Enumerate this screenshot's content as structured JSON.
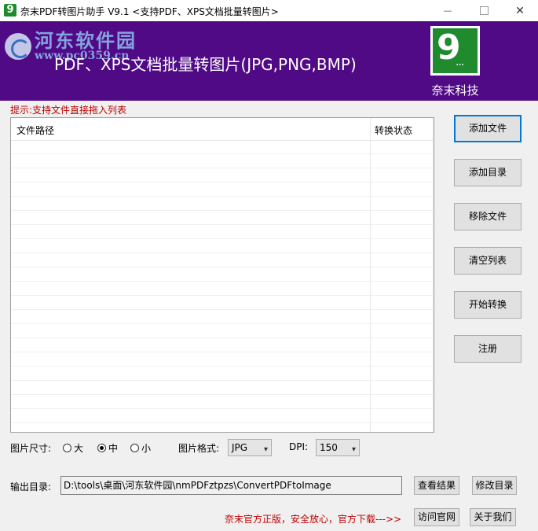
{
  "window": {
    "title": "奈末PDF转图片助手 V9.1 <支持PDF、XPS文档批量转图片>",
    "app_icon_glyph": "9",
    "min_glyph": "—",
    "close_glyph": "✕"
  },
  "banner": {
    "watermark_name": "河东软件园",
    "watermark_url": "www.pc0359.cn",
    "title": "PDF、XPS文档批量转图片(JPG,PNG,BMP)",
    "logo_glyph": "9",
    "logo_dots": "...",
    "brand_name": "奈末科技",
    "background": "#500a86",
    "logo_color": "#1f8b2e"
  },
  "hint": "提示:支持文件直接拖入列表",
  "file_list": {
    "columns": [
      "文件路径",
      "转换状态"
    ],
    "rows": []
  },
  "side_buttons": {
    "add_file": "添加文件",
    "add_dir": "添加目录",
    "remove_file": "移除文件",
    "clear_list": "清空列表",
    "start": "开始转换",
    "register": "注册"
  },
  "options": {
    "size_label": "图片尺寸:",
    "sizes": [
      "大",
      "中",
      "小"
    ],
    "size_selected": "中",
    "format_label": "图片格式:",
    "format_value": "JPG",
    "dpi_label": "DPI:",
    "dpi_value": "150",
    "dropdown_glyph": "▾"
  },
  "output": {
    "label": "输出目录:",
    "path": "D:\\tools\\桌面\\河东软件园\\nmPDFztpzs\\ConvertPDFtoImage",
    "view_result": "查看结果",
    "change_dir": "修改目录"
  },
  "footer": {
    "slogan": "奈末官方正版，安全放心，官方下载--->>",
    "visit_site": "访问官网",
    "about": "关于我们"
  }
}
